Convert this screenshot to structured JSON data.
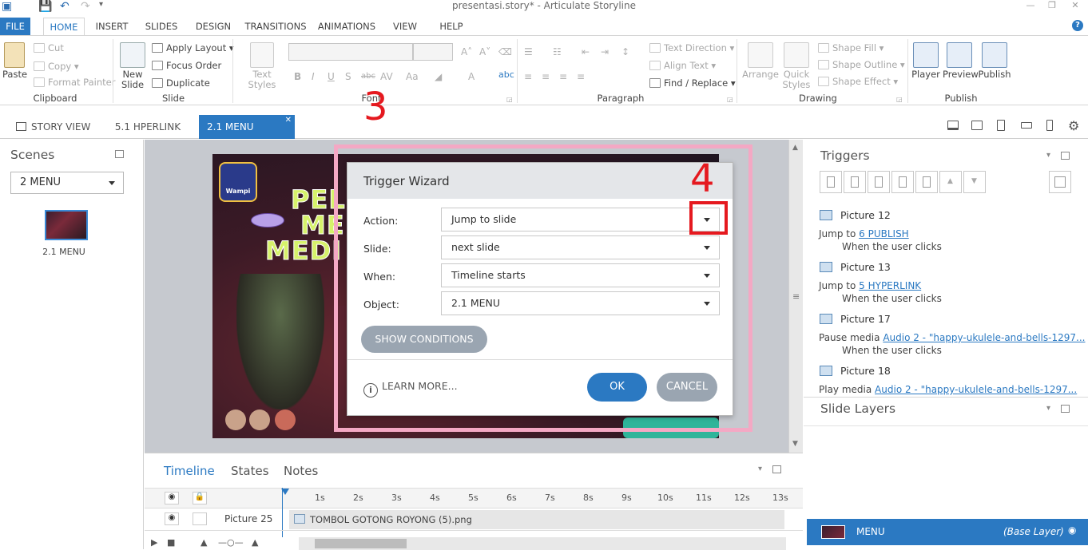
{
  "window": {
    "title": "presentasi.story* - Articulate Storyline"
  },
  "ribbon_tabs": [
    "FILE",
    "HOME",
    "INSERT",
    "SLIDES",
    "DESIGN",
    "TRANSITIONS",
    "ANIMATIONS",
    "VIEW",
    "HELP"
  ],
  "ribbon": {
    "clipboard": {
      "paste": "Paste",
      "cut": "Cut",
      "copy": "Copy",
      "format_painter": "Format Painter",
      "label": "Clipboard"
    },
    "slide": {
      "new_slide_line1": "New",
      "new_slide_line2": "Slide",
      "apply_layout": "Apply Layout",
      "focus_order": "Focus Order",
      "duplicate": "Duplicate",
      "label": "Slide"
    },
    "font": {
      "text_styles_line1": "Text Styles",
      "label": "Font"
    },
    "paragraph": {
      "text_direction": "Text Direction",
      "align_text": "Align Text",
      "find_replace": "Find / Replace",
      "label": "Paragraph"
    },
    "drawing": {
      "arrange": "Arrange",
      "quick_styles_line1": "Quick",
      "quick_styles_line2": "Styles",
      "shape_fill": "Shape Fill",
      "shape_outline": "Shape Outline",
      "shape_effect": "Shape Effect",
      "label": "Drawing"
    },
    "publish": {
      "player": "Player",
      "preview": "Preview",
      "publish": "Publish",
      "label": "Publish"
    }
  },
  "doc_tabs": {
    "story_view": "STORY VIEW",
    "tab1": "5.1 HPERLINK",
    "tab2": "2.1 MENU"
  },
  "scenes": {
    "title": "Scenes",
    "selected": "2 MENU",
    "thumb_label": "2.1 MENU"
  },
  "annotations": {
    "step3": "3",
    "step4": "4"
  },
  "slide": {
    "logo_line1": "Wampi",
    "title_line1": "PEL",
    "title_line2": "ME",
    "title_line3": "MEDI"
  },
  "wizard": {
    "title": "Trigger Wizard",
    "action_label": "Action:",
    "action_value": "Jump to slide",
    "slide_label": "Slide:",
    "slide_value": "next slide",
    "when_label": "When:",
    "when_value": "Timeline starts",
    "object_label": "Object:",
    "object_value": "2.1 MENU",
    "show_conditions": "SHOW CONDITIONS",
    "learn_more": "LEARN MORE...",
    "ok": "OK",
    "cancel": "CANCEL"
  },
  "timeline": {
    "tabs": [
      "Timeline",
      "States",
      "Notes"
    ],
    "ticks": [
      "1s",
      "2s",
      "3s",
      "4s",
      "5s",
      "6s",
      "7s",
      "8s",
      "9s",
      "10s",
      "11s",
      "12s",
      "13s"
    ],
    "row_name": "Picture 25",
    "row_file": "TOMBOL GOTONG ROYONG (5).png"
  },
  "triggers": {
    "title": "Triggers",
    "items": [
      {
        "object": "Picture 12",
        "action": "Jump to",
        "target": "6 PUBLISH",
        "condition": "When the user clicks"
      },
      {
        "object": "Picture 13",
        "action": "Jump to",
        "target": "5 HYPERLINK",
        "condition": "When the user clicks"
      },
      {
        "object": "Picture 17",
        "action": "Pause media",
        "target": "Audio 2 - \"happy-ukulele-and-bells-1297...",
        "condition": "When the user clicks"
      },
      {
        "object": "Picture 18",
        "action": "Play media",
        "target": "Audio 2 - \"happy-ukulele-and-bells-1297...",
        "condition": ""
      }
    ]
  },
  "slide_layers": {
    "title": "Slide Layers",
    "base_name": "MENU",
    "base_tag": "(Base Layer)"
  }
}
